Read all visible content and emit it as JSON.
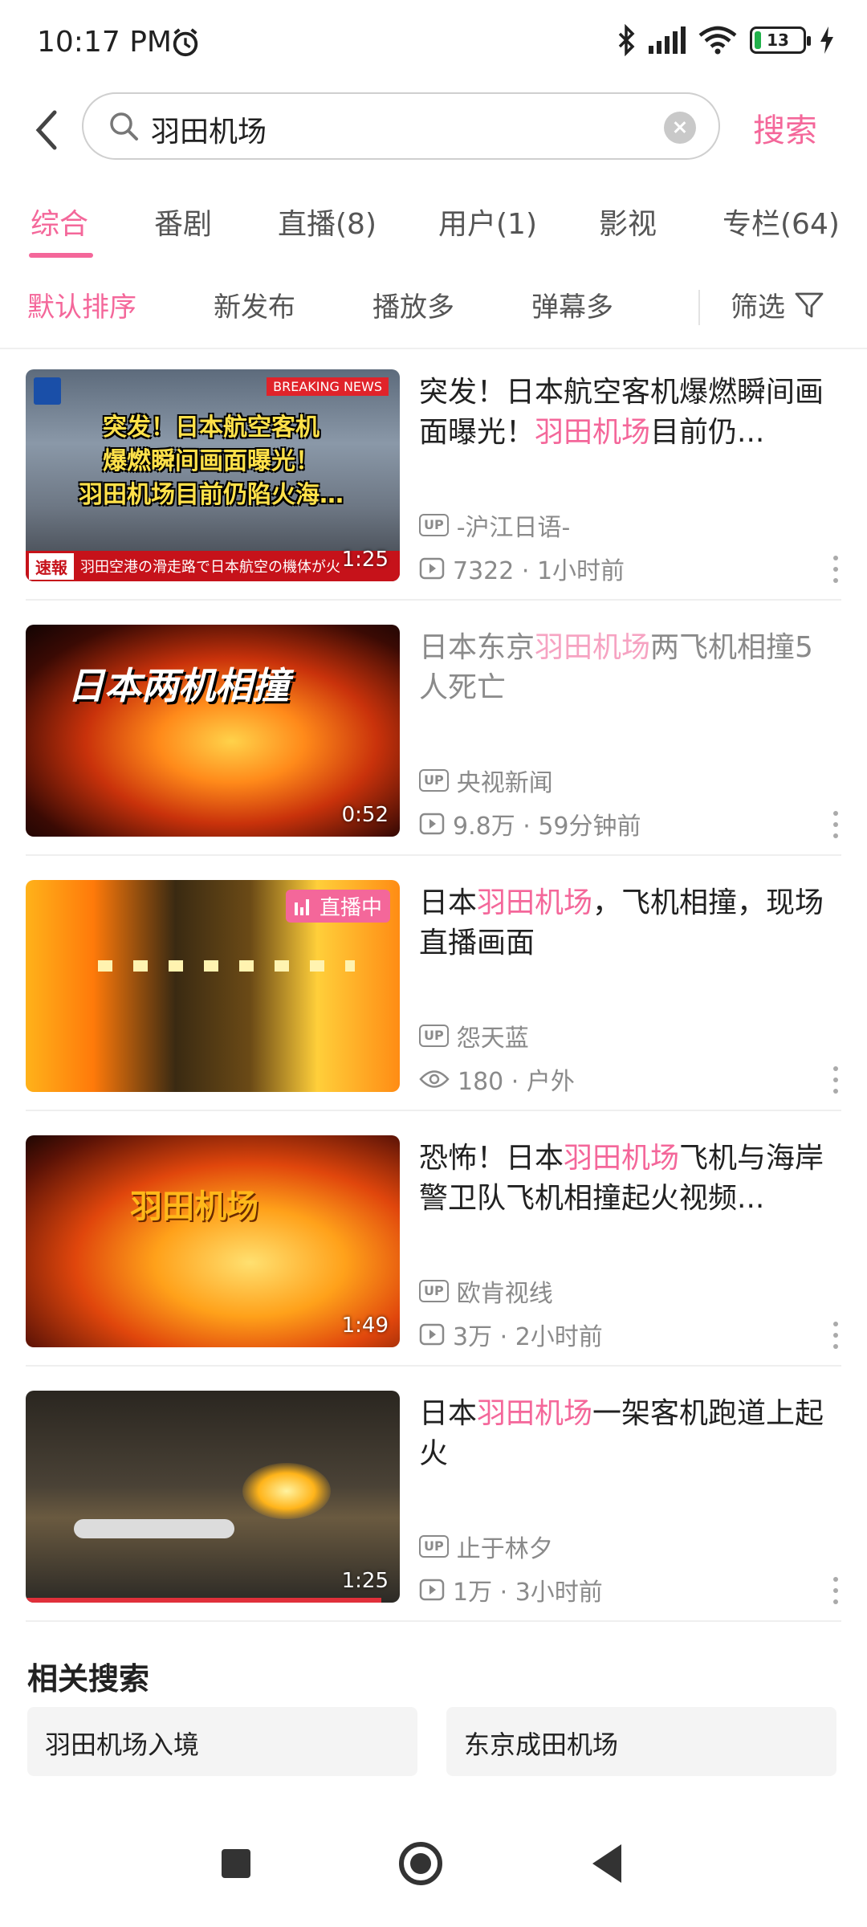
{
  "status": {
    "time": "10:17 PM",
    "battery": "13"
  },
  "search": {
    "query": "羽田机场",
    "button": "搜索"
  },
  "tabs": [
    {
      "label": "综合"
    },
    {
      "label": "番剧"
    },
    {
      "label": "直播(8)"
    },
    {
      "label": "用户(1)"
    },
    {
      "label": "影视"
    },
    {
      "label": "专栏(64)"
    }
  ],
  "sort": {
    "options": [
      "默认排序",
      "新发布",
      "播放多",
      "弹幕多"
    ],
    "filter": "筛选"
  },
  "videos": [
    {
      "title_pre": "突发！日本航空客机爆燃瞬间画面曝光！",
      "title_hl": "羽田机场",
      "title_post": "目前仍...",
      "uploader": "-沪江日语-",
      "stats": "7322 · 1小时前",
      "duration": "1:25",
      "thumb_text": [
        "突发！日本航空客机",
        "爆燃瞬间画面曝光！",
        "羽田机场目前仍陷火海…"
      ],
      "thumb_tag": "BREAKING NEWS",
      "thumb_banner": "速報",
      "thumb_banner_text": "羽田空港の滑走路で日本航空の機体が火"
    },
    {
      "title_pre": "日本东京",
      "title_hl": "羽田机场",
      "title_post": "两飞机相撞5人死亡",
      "uploader": "央视新闻",
      "stats": "9.8万 · 59分钟前",
      "duration": "0:52",
      "thumb_text": [
        "日本两机相撞"
      ]
    },
    {
      "title_pre": "日本",
      "title_hl": "羽田机场",
      "title_post": "，飞机相撞，现场直播画面",
      "uploader": "怨天蓝",
      "stats": "180 · 户外",
      "live_label": "直播中"
    },
    {
      "title_pre": "恐怖！日本",
      "title_hl": "羽田机场",
      "title_post": "飞机与海岸警卫队飞机相撞起火视频...",
      "uploader": "欧肯视线",
      "stats": "3万 · 2小时前",
      "duration": "1:49",
      "thumb_text": [
        "羽田机场"
      ]
    },
    {
      "title_pre": "日本",
      "title_hl": "羽田机场",
      "title_post": "一架客机跑道上起火",
      "uploader": "止于林夕",
      "stats": "1万 · 3小时前",
      "duration": "1:25"
    }
  ],
  "related": {
    "title": "相关搜索",
    "items": [
      "羽田机场入境",
      "东京成田机场"
    ]
  },
  "colors": {
    "accent": "#f4679a",
    "text": "#212121",
    "muted": "#8a8a8a"
  }
}
